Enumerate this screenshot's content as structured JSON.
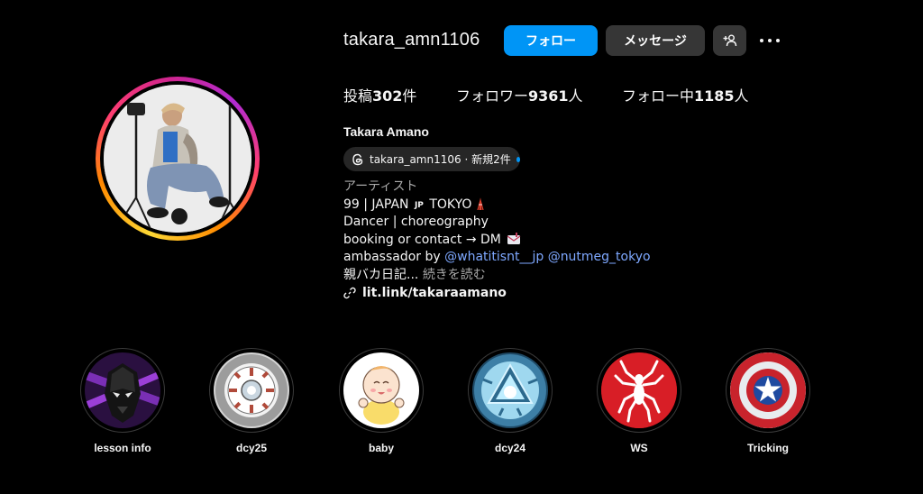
{
  "profile": {
    "username": "takara_amn1106",
    "full_name": "Takara Amano",
    "follow_label": "フォロー",
    "message_label": "メッセージ"
  },
  "stats": {
    "posts_prefix": "投稿",
    "posts_count": "302",
    "posts_suffix": "件",
    "followers_prefix": "フォロワー",
    "followers_count": "9361",
    "followers_suffix": "人",
    "following_prefix": "フォロー中",
    "following_count": "1185",
    "following_suffix": "人"
  },
  "threads": {
    "text": "takara_amn1106 · 新規2件"
  },
  "bio": {
    "category": "アーティスト",
    "line1_pre": "99 | JAPAN ",
    "line1_flag": "JP",
    "line1_post": " TOKYO",
    "line2": "Dancer | choreography",
    "line3": "booking or contact → DM",
    "line4_pre": "ambassador by ",
    "mention1": "@whatitisnt__jp",
    "mention2": "@nutmeg_tokyo",
    "line5": "親バカ日記...",
    "read_more": "続きを読む",
    "link": "lit.link/takaraamano"
  },
  "highlights": [
    {
      "label": "lesson info",
      "icon": "panther-mask-icon"
    },
    {
      "label": "dcy25",
      "icon": "arc-reactor-badge-icon"
    },
    {
      "label": "baby",
      "icon": "baby-icon"
    },
    {
      "label": "dcy24",
      "icon": "arc-reactor-icon"
    },
    {
      "label": "WS",
      "icon": "spider-icon"
    },
    {
      "label": "Tricking",
      "icon": "shield-star-icon"
    }
  ],
  "colors": {
    "background": "#000000",
    "primary_button": "#0095f6",
    "secondary_button": "#363636",
    "mention": "#7ea8ff",
    "muted": "#a8a8a8"
  }
}
